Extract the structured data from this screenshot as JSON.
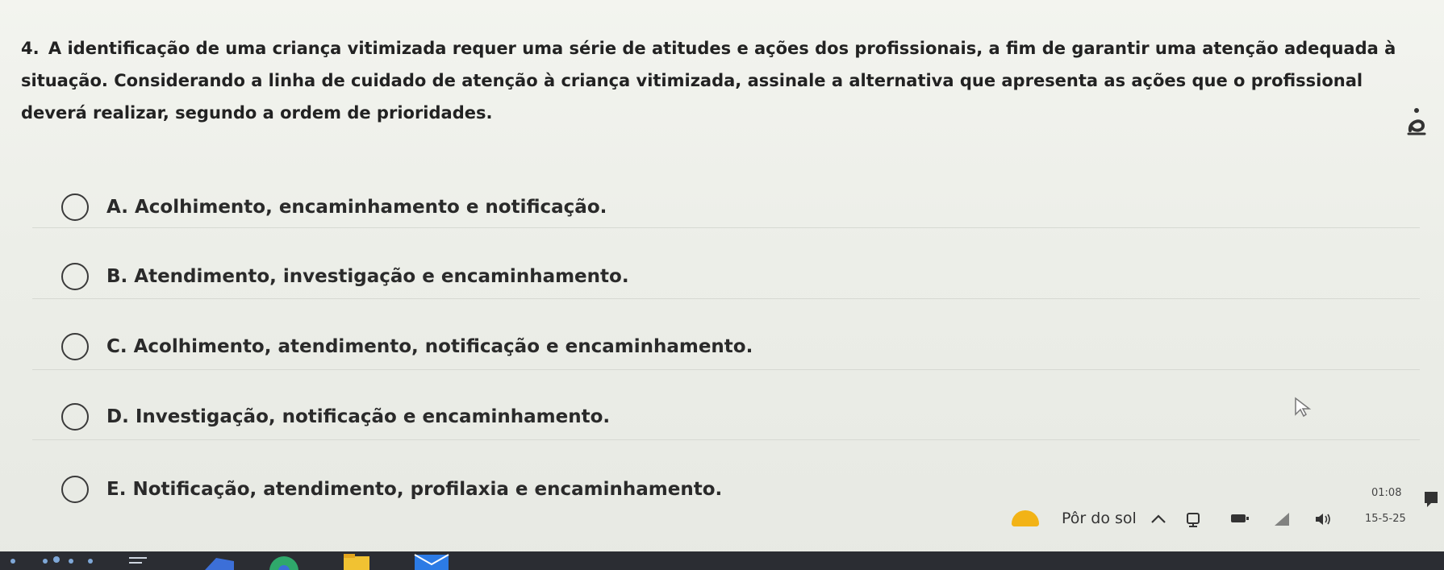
{
  "question": {
    "number": "4.",
    "text": "A identificação de uma criança vitimizada requer uma série de atitudes e ações dos profissionais, a fim de garantir uma atenção adequada à situação. Considerando a linha de cuidado de atenção à criança vitimizada, assinale a alternativa que apresenta as ações que o profissional deverá realizar, segundo a ordem de prioridades."
  },
  "options": [
    {
      "label": "A. Acolhimento, encaminhamento e notificação."
    },
    {
      "label": "B. Atendimento, investigação e encaminhamento."
    },
    {
      "label": "C. Acolhimento, atendimento, notificação e encaminhamento."
    },
    {
      "label": "D. Investigação, notificação e encaminhamento."
    },
    {
      "label": "E. Notificação, atendimento, profilaxia e encaminhamento."
    }
  ],
  "taskbar": {
    "weather_label": "Pôr do sol",
    "clock_time": "01:08",
    "clock_date": "15-5-25"
  },
  "colors": {
    "weather_sun": "#f2b316",
    "dock": "#2b2d33"
  },
  "icons": {
    "ai_assistant": "ai-assistant-icon",
    "chevron_up": "chevron-up-icon",
    "network": "network-icon",
    "battery": "battery-icon",
    "volume": "volume-icon",
    "notifications": "notification-icon"
  }
}
